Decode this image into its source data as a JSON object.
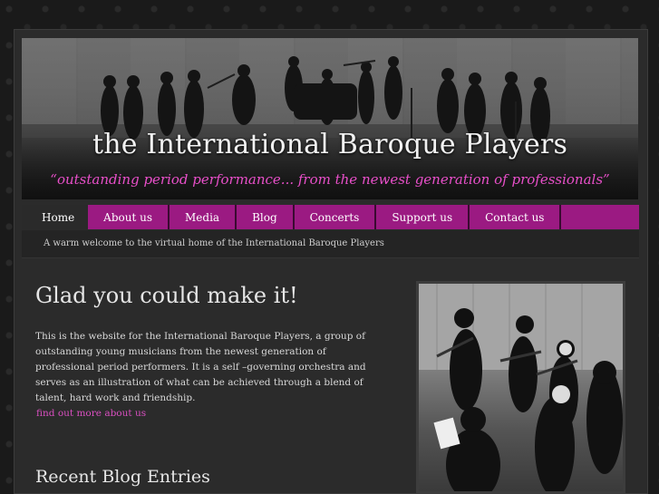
{
  "header": {
    "title": "the International Baroque Players",
    "tagline": "“outstanding period performance... from the newest generation of professionals”"
  },
  "nav": {
    "items": [
      {
        "label": "Home",
        "active": true
      },
      {
        "label": "About us",
        "active": false
      },
      {
        "label": "Media",
        "active": false
      },
      {
        "label": "Blog",
        "active": false
      },
      {
        "label": "Concerts",
        "active": false
      },
      {
        "label": "Support us",
        "active": false
      },
      {
        "label": "Contact us",
        "active": false
      }
    ]
  },
  "welcome": {
    "text": "A warm welcome to the virtual home of the International Baroque Players"
  },
  "main": {
    "heading": "Glad you could make it!",
    "intro": "This is the website for the International Baroque Players, a group of outstanding young musicians from the newest generation of professional period performers. It is a self –governing orchestra and serves as an illustration of what can be achieved through a blend of talent, hard work and friendship.",
    "more_link": "find out more about us",
    "blog_heading": "Recent Blog Entries"
  },
  "colors": {
    "accent": "#9b1a82",
    "link": "#d94fc0",
    "tagline": "#e84fc9",
    "background": "#1a1a1a"
  }
}
